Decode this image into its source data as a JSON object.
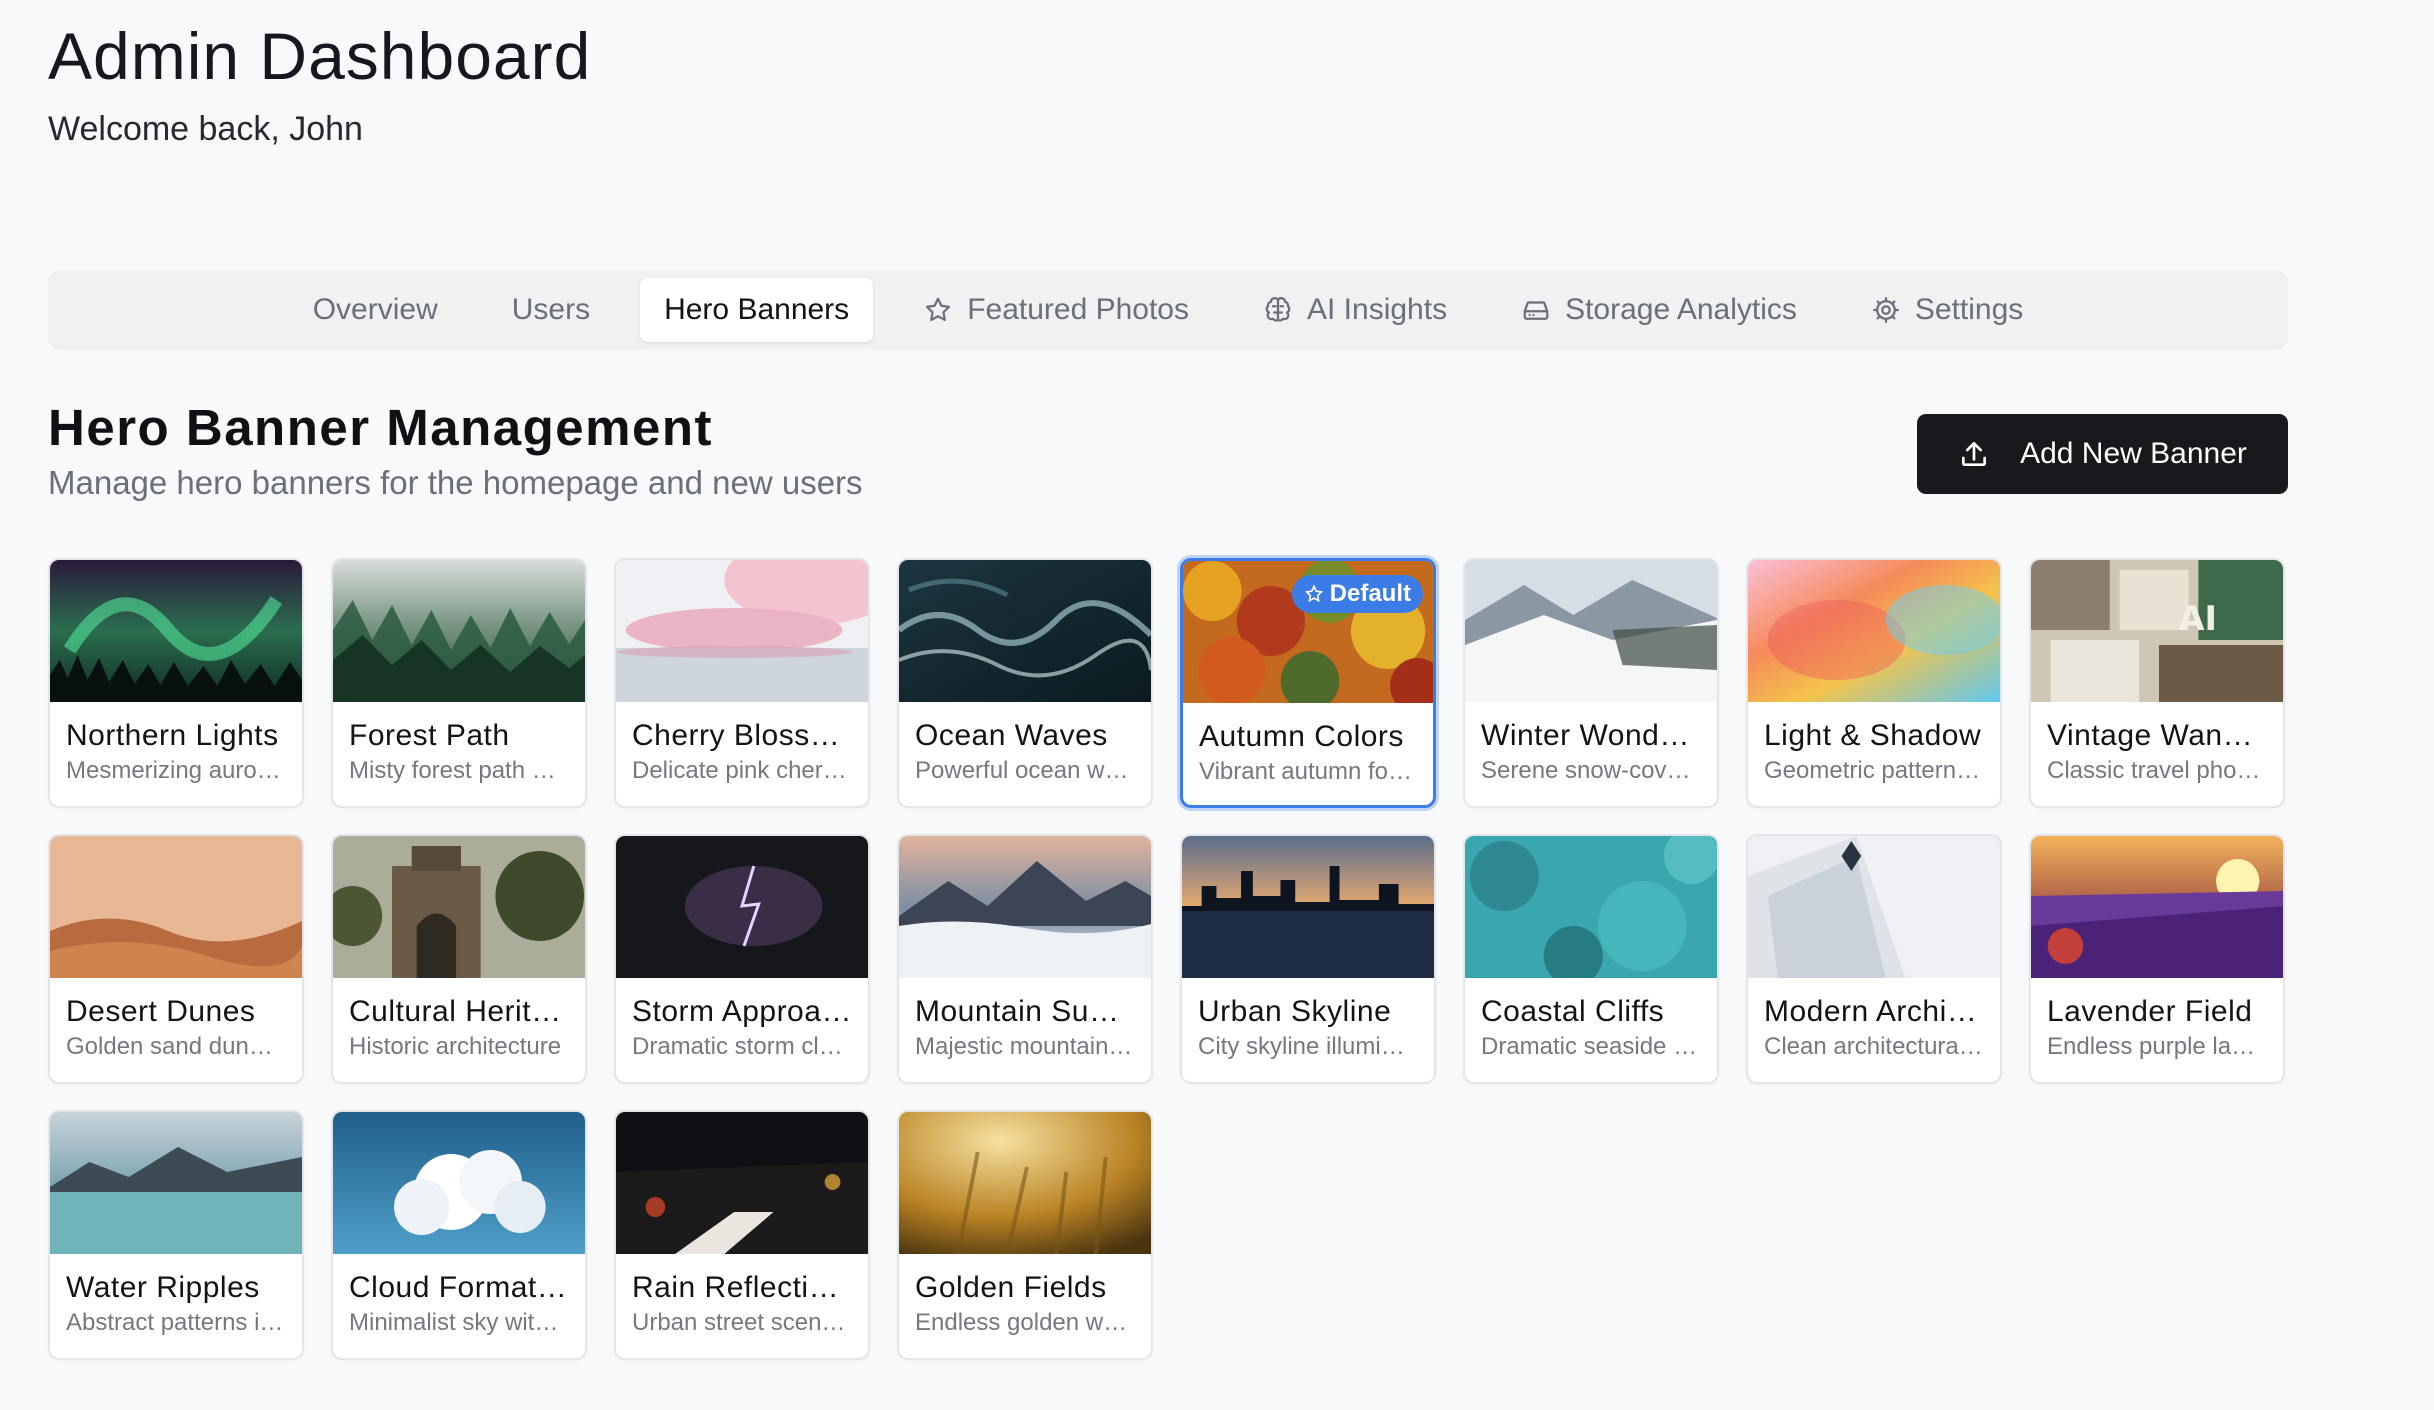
{
  "header": {
    "title": "Admin Dashboard",
    "welcome": "Welcome back, John"
  },
  "tabs": [
    {
      "label": "Overview",
      "icon": "",
      "active": false
    },
    {
      "label": "Users",
      "icon": "",
      "active": false
    },
    {
      "label": "Hero Banners",
      "icon": "",
      "active": true
    },
    {
      "label": "Featured Photos",
      "icon": "star-icon",
      "active": false
    },
    {
      "label": "AI Insights",
      "icon": "brain-icon",
      "active": false
    },
    {
      "label": "Storage Analytics",
      "icon": "hard-drive-icon",
      "active": false
    },
    {
      "label": "Settings",
      "icon": "gear-icon",
      "active": false
    }
  ],
  "section": {
    "title": "Hero Banner Management",
    "subtitle": "Manage hero banners for the homepage and new users",
    "add_button_label": "Add New Banner",
    "add_button_icon": "upload-icon"
  },
  "default_badge": "Default",
  "colors": {
    "accent": "#3b7ce6",
    "primary_button": "#18191c"
  },
  "banners": [
    {
      "title": "Northern Lights",
      "description": "Mesmerizing aurora borealis",
      "theme": "aurora",
      "is_default": false
    },
    {
      "title": "Forest Path",
      "description": "Misty forest path at dawn",
      "theme": "forest",
      "is_default": false
    },
    {
      "title": "Cherry Blossoms",
      "description": "Delicate pink cherry blossoms",
      "theme": "cherry",
      "is_default": false
    },
    {
      "title": "Ocean Waves",
      "description": "Powerful ocean waves",
      "theme": "ocean",
      "is_default": false
    },
    {
      "title": "Autumn Colors",
      "description": "Vibrant autumn foliage",
      "theme": "autumn",
      "is_default": true
    },
    {
      "title": "Winter Wonderland",
      "description": "Serene snow-covered landscape",
      "theme": "winter",
      "is_default": false
    },
    {
      "title": "Light & Shadow",
      "description": "Geometric patterns of light",
      "theme": "gradient",
      "is_default": false
    },
    {
      "title": "Vintage Wanderlust",
      "description": "Classic travel photography",
      "theme": "vintage",
      "is_default": false
    },
    {
      "title": "Desert Dunes",
      "description": "Golden sand dunes at sunset",
      "theme": "desert",
      "is_default": false
    },
    {
      "title": "Cultural Heritage",
      "description": "Historic architecture",
      "theme": "heritage",
      "is_default": false
    },
    {
      "title": "Storm Approaching",
      "description": "Dramatic storm clouds",
      "theme": "storm",
      "is_default": false
    },
    {
      "title": "Mountain Summit",
      "description": "Majestic mountain peaks",
      "theme": "mountain",
      "is_default": false
    },
    {
      "title": "Urban Skyline",
      "description": "City skyline illuminated",
      "theme": "skyline",
      "is_default": false
    },
    {
      "title": "Coastal Cliffs",
      "description": "Dramatic seaside cliffs",
      "theme": "coastal",
      "is_default": false
    },
    {
      "title": "Modern Architecture",
      "description": "Clean architectural lines",
      "theme": "modern",
      "is_default": false
    },
    {
      "title": "Lavender Field",
      "description": "Endless purple lavender",
      "theme": "lavender",
      "is_default": false
    },
    {
      "title": "Water Ripples",
      "description": "Abstract patterns in water",
      "theme": "water",
      "is_default": false
    },
    {
      "title": "Cloud Formations",
      "description": "Minimalist sky with clouds",
      "theme": "cloud",
      "is_default": false
    },
    {
      "title": "Rain Reflections",
      "description": "Urban street scene at night",
      "theme": "rain",
      "is_default": false
    },
    {
      "title": "Golden Fields",
      "description": "Endless golden wheat",
      "theme": "golden",
      "is_default": false
    }
  ]
}
